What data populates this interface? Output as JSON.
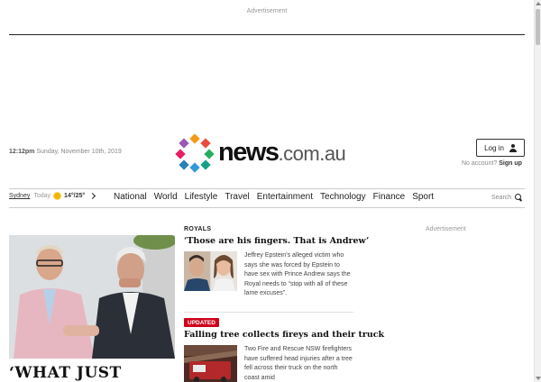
{
  "ads": {
    "top_label": "Advertisement",
    "side_label": "Advertisement"
  },
  "header": {
    "time": "12:12pm",
    "date": "Sunday, November 10th, 2019",
    "logo_main": "news",
    "logo_suffix": ".com.au",
    "login_label": "Log in",
    "no_account_label": "No account?",
    "sign_up_label": "Sign up"
  },
  "weather": {
    "city": "Sydney",
    "day": "Today",
    "temps": "14°/25°",
    "icon": "sun-icon"
  },
  "nav": {
    "items": [
      "National",
      "World",
      "Lifestyle",
      "Travel",
      "Entertainment",
      "Technology",
      "Finance",
      "Sport"
    ],
    "search_label": "Search"
  },
  "hero": {
    "headline": "‘WHAT JUST"
  },
  "stories": [
    {
      "kicker": "ROYALS",
      "title": "‘Those are his fingers. That is Andrew’",
      "summary": "Jeffrey Epstein’s alleged victim who says she was forced by Epstein to have sex with Prince Andrew says the Royal needs to “stop with all of these lame excuses”."
    },
    {
      "badge": "UPDATED",
      "title": "Falling tree collects fireys and their truck",
      "summary": "Two Fire and Rescue NSW firefighters have suffered head injuries after a tree fell across their truck on the north coast amid"
    }
  ],
  "colors": {
    "accent_red": "#d0021b",
    "logo_dark": "#111111"
  }
}
